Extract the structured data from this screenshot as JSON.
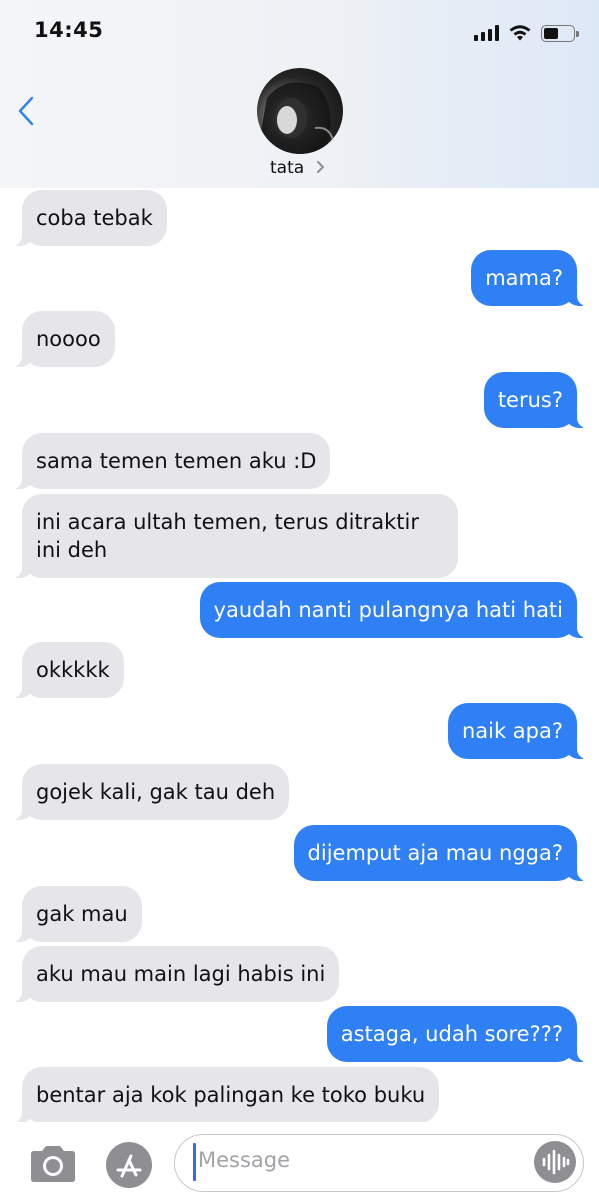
{
  "status_bar": {
    "time": "14:45"
  },
  "header": {
    "contact_name": "tata"
  },
  "messages": [
    {
      "side": "in",
      "text": "coba tebak"
    },
    {
      "side": "out",
      "text": "mama?"
    },
    {
      "side": "in",
      "text": "noooo"
    },
    {
      "side": "out",
      "text": "terus?"
    },
    {
      "side": "in",
      "text": "sama temen temen aku :D"
    },
    {
      "side": "in",
      "text": "ini acara ultah temen, terus ditraktir ini deh"
    },
    {
      "side": "out",
      "text": "yaudah nanti pulangnya hati hati"
    },
    {
      "side": "in",
      "text": "okkkkk"
    },
    {
      "side": "out",
      "text": "naik apa?"
    },
    {
      "side": "in",
      "text": "gojek kali, gak tau deh"
    },
    {
      "side": "out",
      "text": "dijemput aja mau ngga?"
    },
    {
      "side": "in",
      "text": "gak mau"
    },
    {
      "side": "in",
      "text": "aku mau main lagi habis ini"
    },
    {
      "side": "out",
      "text": "astaga, udah sore???"
    },
    {
      "side": "in",
      "text": "bentar aja kok palingan ke toko buku"
    }
  ],
  "composer": {
    "placeholder": "Message"
  },
  "colors": {
    "outgoing": "#2f80f5",
    "incoming": "#e5e5ea"
  },
  "icons": [
    "back-chevron-icon",
    "camera-icon",
    "app-store-icon",
    "audio-waveform-icon"
  ]
}
